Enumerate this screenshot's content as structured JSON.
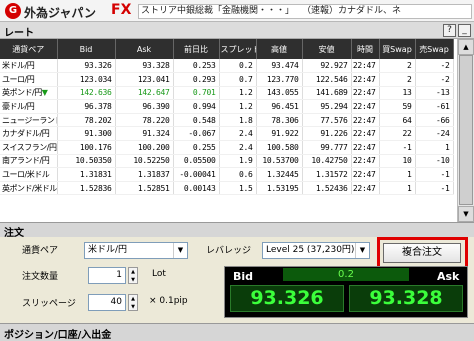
{
  "app": {
    "logo_mark": "G",
    "name": "外為ジャパン",
    "fx": "FX"
  },
  "news": {
    "item1": "ストリア中銀総裁「金融機関・・・」",
    "item2": "（速報）カナダドル、ネ"
  },
  "rate_panel": {
    "title": "レート",
    "help_label": "?",
    "minimize_label": "_",
    "columns": [
      "通貨ペア",
      "Bid",
      "Ask",
      "前日比",
      "スプレッド",
      "高値",
      "安値",
      "時間",
      "買Swap",
      "売Swap"
    ],
    "rows": [
      {
        "pair": "米ドル/円",
        "bid": "93.326",
        "ask": "93.328",
        "chg": "0.253",
        "spread": "0.2",
        "high": "93.474",
        "low": "92.927",
        "time": "22:47",
        "buy_swap": "2",
        "sell_swap": "-2"
      },
      {
        "pair": "ユーロ/円",
        "bid": "123.034",
        "ask": "123.041",
        "chg": "0.293",
        "spread": "0.7",
        "high": "123.770",
        "low": "122.546",
        "time": "22:47",
        "buy_swap": "2",
        "sell_swap": "-2"
      },
      {
        "pair": "英ポンド/円",
        "arrow": "▼",
        "bid": "142.636",
        "ask": "142.647",
        "chg": "0.701",
        "spread": "1.2",
        "high": "143.055",
        "low": "141.689",
        "time": "22:47",
        "buy_swap": "13",
        "sell_swap": "-13",
        "up": true
      },
      {
        "pair": "豪ドル/円",
        "bid": "96.378",
        "ask": "96.390",
        "chg": "0.994",
        "spread": "1.2",
        "high": "96.451",
        "low": "95.294",
        "time": "22:47",
        "buy_swap": "59",
        "sell_swap": "-61"
      },
      {
        "pair": "ニュージーランドドル",
        "bid": "78.202",
        "ask": "78.220",
        "chg": "0.548",
        "spread": "1.8",
        "high": "78.306",
        "low": "77.576",
        "time": "22:47",
        "buy_swap": "64",
        "sell_swap": "-66"
      },
      {
        "pair": "カナダドル/円",
        "bid": "91.300",
        "ask": "91.324",
        "chg": "-0.067",
        "spread": "2.4",
        "high": "91.922",
        "low": "91.226",
        "time": "22:47",
        "buy_swap": "22",
        "sell_swap": "-24"
      },
      {
        "pair": "スイスフラン/円",
        "bid": "100.176",
        "ask": "100.200",
        "chg": "0.255",
        "spread": "2.4",
        "high": "100.580",
        "low": "99.777",
        "time": "22:47",
        "buy_swap": "-1",
        "sell_swap": "1"
      },
      {
        "pair": "南アランド/円",
        "bid": "10.50350",
        "ask": "10.52250",
        "chg": "0.05500",
        "spread": "1.9",
        "high": "10.53700",
        "low": "10.42750",
        "time": "22:47",
        "buy_swap": "10",
        "sell_swap": "-10"
      },
      {
        "pair": "ユーロ/米ドル",
        "bid": "1.31831",
        "ask": "1.31837",
        "chg": "-0.00041",
        "spread": "0.6",
        "high": "1.32445",
        "low": "1.31572",
        "time": "22:47",
        "buy_swap": "1",
        "sell_swap": "-1"
      },
      {
        "pair": "英ポンド/米ドル",
        "bid": "1.52836",
        "ask": "1.52851",
        "chg": "0.00143",
        "spread": "1.5",
        "high": "1.53195",
        "low": "1.52436",
        "time": "22:47",
        "buy_swap": "1",
        "sell_swap": "-1"
      }
    ]
  },
  "order_panel": {
    "title": "注文",
    "pair_label": "通貨ペア",
    "pair_value": "米ドル/円",
    "leverage_label": "レバレッジ",
    "leverage_value": "Level 25 (37,230円)",
    "combo_button": "複合注文",
    "quantity_label": "注文数量",
    "quantity_value": "1",
    "quantity_unit": "Lot",
    "slippage_label": "スリッページ",
    "slippage_value": "40",
    "slippage_unit": "× 0.1pip",
    "bid_label": "Bid",
    "ask_label": "Ask",
    "spread": "0.2",
    "bid_price": "93.326",
    "ask_price": "93.328"
  },
  "position_panel": {
    "title": "ポジション/口座/入出金"
  },
  "colors": {
    "up_green": "#1a9a1a",
    "quote_text": "#3bff3b",
    "highlight_red": "#e00000",
    "brand_red": "#d40000"
  }
}
